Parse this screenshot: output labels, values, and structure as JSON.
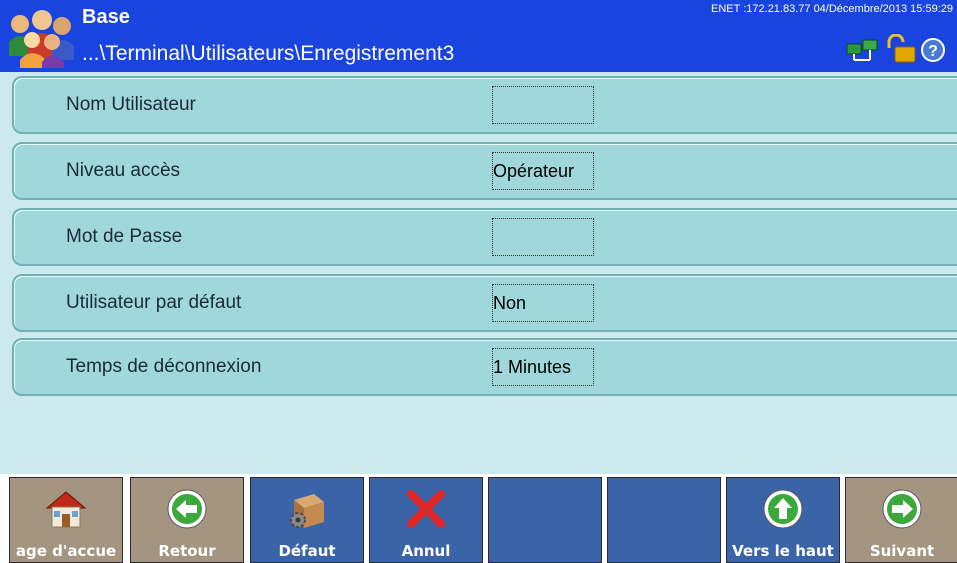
{
  "header": {
    "title": "Base",
    "path": "...\\Terminal\\Utilisateurs\\Enregistrement3",
    "status": "ENET :172.21.83.77  04/Décembre/2013 15:59:29",
    "icons": [
      "users-icon",
      "network-icon",
      "padlock-open-icon",
      "help-icon"
    ]
  },
  "fields": [
    {
      "label": "Nom Utilisateur",
      "value": ""
    },
    {
      "label": "Niveau accès",
      "value": "Opérateur"
    },
    {
      "label": "Mot de Passe",
      "value": ""
    },
    {
      "label": "Utilisateur par défaut",
      "value": "Non"
    },
    {
      "label": "Temps de déconnexion",
      "value": "1 Minutes"
    }
  ],
  "toolbar": [
    {
      "label": "age d'accue",
      "icon": "home-icon"
    },
    {
      "label": "Retour",
      "icon": "arrow-left-icon"
    },
    {
      "label": "Défaut",
      "icon": "box-gear-icon"
    },
    {
      "label": "Annul",
      "icon": "red-x-icon"
    },
    {
      "label": "",
      "icon": ""
    },
    {
      "label": "",
      "icon": ""
    },
    {
      "label": "Vers le haut",
      "icon": "arrow-up-icon"
    },
    {
      "label": "Suivant",
      "icon": "arrow-right-icon"
    }
  ],
  "colors": {
    "header_bg": "#1a44e0",
    "content_bg": "#cce9ee",
    "row_bg": "#9fd7da",
    "button_tan": "#a3957f",
    "button_blue": "#3b64a8"
  }
}
